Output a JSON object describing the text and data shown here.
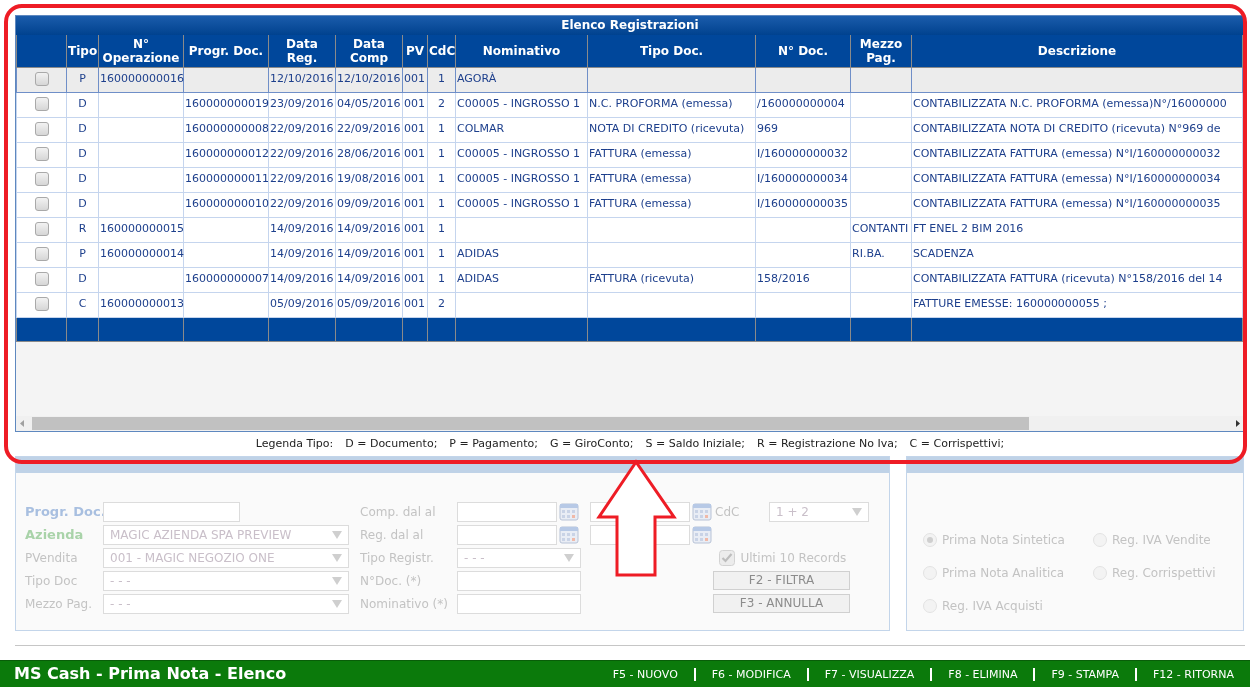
{
  "table": {
    "title": "Elenco Registrazioni",
    "columns": [
      "Tipo",
      "N° Operazione",
      "Progr. Doc.",
      "Data Reg.",
      "Data Comp",
      "PV",
      "CdC",
      "Nominativo",
      "Tipo Doc.",
      "N° Doc.",
      "Mezzo Pag.",
      "Descrizione"
    ],
    "rows": [
      {
        "selected": true,
        "checked": false,
        "cells": [
          "P",
          "160000000016",
          "",
          "12/10/2016",
          "12/10/2016",
          "001",
          "1",
          "AGORÀ",
          "",
          "",
          "",
          ""
        ]
      },
      {
        "selected": false,
        "checked": false,
        "cells": [
          "D",
          "",
          "160000000019",
          "23/09/2016",
          "04/05/2016",
          "001",
          "2",
          "C00005 - INGROSSO 1",
          "N.C. PROFORMA (emessa)",
          "/160000000004",
          "",
          "CONTABILIZZATA N.C. PROFORMA (emessa)N°/16000000"
        ]
      },
      {
        "selected": false,
        "checked": false,
        "cells": [
          "D",
          "",
          "160000000008",
          "22/09/2016",
          "22/09/2016",
          "001",
          "1",
          "COLMAR",
          "NOTA DI CREDITO (ricevuta)",
          "969",
          "",
          "CONTABILIZZATA NOTA DI CREDITO (ricevuta) N°969 de"
        ]
      },
      {
        "selected": false,
        "checked": false,
        "cells": [
          "D",
          "",
          "160000000012",
          "22/09/2016",
          "28/06/2016",
          "001",
          "1",
          "C00005 - INGROSSO 1",
          "FATTURA (emessa)",
          "I/160000000032",
          "",
          "CONTABILIZZATA FATTURA (emessa) N°I/160000000032"
        ]
      },
      {
        "selected": false,
        "checked": false,
        "cells": [
          "D",
          "",
          "160000000011",
          "22/09/2016",
          "19/08/2016",
          "001",
          "1",
          "C00005 - INGROSSO 1",
          "FATTURA (emessa)",
          "I/160000000034",
          "",
          "CONTABILIZZATA FATTURA (emessa) N°I/160000000034"
        ]
      },
      {
        "selected": false,
        "checked": false,
        "cells": [
          "D",
          "",
          "160000000010",
          "22/09/2016",
          "09/09/2016",
          "001",
          "1",
          "C00005 - INGROSSO 1",
          "FATTURA (emessa)",
          "I/160000000035",
          "",
          "CONTABILIZZATA FATTURA (emessa) N°I/160000000035"
        ]
      },
      {
        "selected": false,
        "checked": false,
        "cells": [
          "R",
          "160000000015",
          "",
          "14/09/2016",
          "14/09/2016",
          "001",
          "1",
          "",
          "",
          "",
          "CONTANTI",
          "FT ENEL 2 BIM 2016"
        ]
      },
      {
        "selected": false,
        "checked": false,
        "cells": [
          "P",
          "160000000014",
          "",
          "14/09/2016",
          "14/09/2016",
          "001",
          "1",
          "ADIDAS",
          "",
          "",
          "RI.BA.",
          "SCADENZA"
        ]
      },
      {
        "selected": false,
        "checked": false,
        "cells": [
          "D",
          "",
          "160000000007",
          "14/09/2016",
          "14/09/2016",
          "001",
          "1",
          "ADIDAS",
          "FATTURA (ricevuta)",
          "158/2016",
          "",
          "CONTABILIZZATA FATTURA (ricevuta) N°158/2016 del 14"
        ]
      },
      {
        "selected": false,
        "checked": false,
        "cells": [
          "C",
          "160000000013",
          "",
          "05/09/2016",
          "05/09/2016",
          "001",
          "2",
          "",
          "",
          "",
          "",
          "FATTURE EMESSE: 160000000055 ;"
        ]
      }
    ]
  },
  "legend": {
    "title": "Legenda Tipo:",
    "items": [
      "D = Documento;",
      "P = Pagamento;",
      "G = GiroConto;",
      "S = Saldo Iniziale;",
      "R = Registrazione No Iva;",
      "C = Corrispettivi;"
    ]
  },
  "filters": {
    "disabled": true,
    "left_fields": [
      {
        "label": "Progr. Doc.",
        "kind": "input",
        "color": "#a8bfe0"
      },
      {
        "label": "Azienda",
        "kind": "select",
        "value": "MAGIC AZIENDA SPA PREVIEW",
        "color": "#a9d3a9"
      },
      {
        "label": "PVendita",
        "kind": "select",
        "value": "001 - MAGIC NEGOZIO ONE"
      },
      {
        "label": "Tipo Doc",
        "kind": "select",
        "value": "- - -"
      },
      {
        "label": "Mezzo Pag.",
        "kind": "select",
        "value": "- - -"
      }
    ],
    "right_fields": [
      {
        "label": "Comp. dal al",
        "kind": "daterange"
      },
      {
        "label": "Reg. dal al",
        "kind": "daterange"
      },
      {
        "label": "Tipo Registr.",
        "kind": "select",
        "value": "- - -"
      },
      {
        "label": "N°Doc. (*)",
        "kind": "input"
      },
      {
        "label": "Nominativo (*)",
        "kind": "input"
      }
    ],
    "cdc": {
      "label": "CdC",
      "value": "1 + 2"
    },
    "last_records": {
      "label": "Ultimi 10 Records",
      "checked": true
    },
    "buttons": [
      "F2 - FILTRA",
      "F3 - ANNULLA"
    ]
  },
  "print_type": {
    "disabled": true,
    "options": [
      {
        "label": "Prima Nota Sintetica",
        "selected": true
      },
      {
        "label": "Reg. IVA Vendite",
        "selected": false
      },
      {
        "label": "Prima Nota Analitica",
        "selected": false
      },
      {
        "label": "Reg. Corrispettivi",
        "selected": false
      },
      {
        "label": "Reg. IVA Acquisti",
        "selected": false
      }
    ]
  },
  "footer": {
    "title": "MS Cash - Prima Nota - Elenco",
    "actions": [
      "F5 - NUOVO",
      "F6 - MODIFICA",
      "F7 - VISUALIZZA",
      "F8 - ELIMINA",
      "F9 - STAMPA",
      "F12 - RITORNA"
    ]
  }
}
